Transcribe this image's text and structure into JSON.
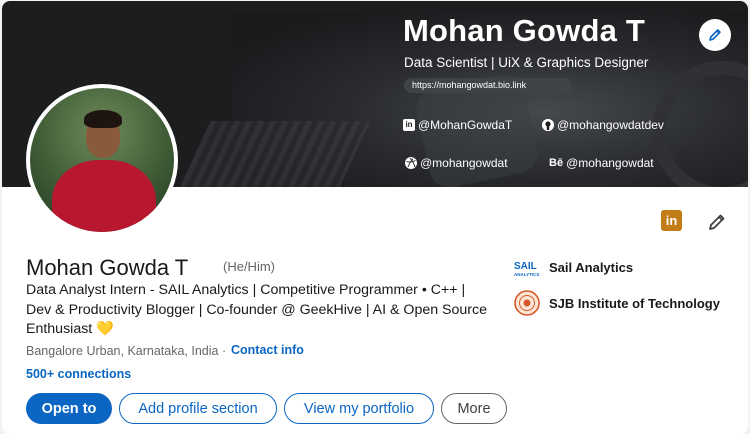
{
  "banner": {
    "name": "Mohan Gowda T",
    "subtitle": "Data Scientist | UiX & Graphics Designer",
    "link": "https://mohangowdat.bio.link",
    "socials": [
      {
        "icon": "linkedin-icon",
        "glyph": "in",
        "handle": "@MohanGowdaT"
      },
      {
        "icon": "github-icon",
        "glyph": "◯",
        "handle": "@mohangowdatdev"
      },
      {
        "icon": "dribbble-icon",
        "glyph": "◎",
        "handle": "@mohangowdat"
      },
      {
        "icon": "behance-icon",
        "glyph": "Bē",
        "handle": "@mohangowdat"
      }
    ]
  },
  "profile": {
    "name": "Mohan Gowda T",
    "pronouns": "(He/Him)",
    "headline": "Data Analyst Intern - SAIL Analytics | Competitive Programmer • C++ | Dev & Productivity Blogger | Co-founder @ GeekHive | AI & Open Source Enthusiast 💛",
    "location": "Bangalore Urban, Karnataka, India",
    "separator": "·",
    "contact_label": "Contact info",
    "connections": "500+ connections"
  },
  "orgs": [
    {
      "name": "Sail Analytics",
      "logo_text": "SAIL",
      "logo_sub": "ANALYTICS"
    },
    {
      "name": "SJB Institute of Technology"
    }
  ],
  "actions": {
    "open_to": "Open to",
    "add_section": "Add profile section",
    "portfolio": "View my portfolio",
    "more": "More"
  },
  "badge": {
    "linkedin_glyph": "in"
  },
  "colors": {
    "accent": "#0a66c2",
    "badge": "#c37d16",
    "banner": "#1c1d1f"
  }
}
